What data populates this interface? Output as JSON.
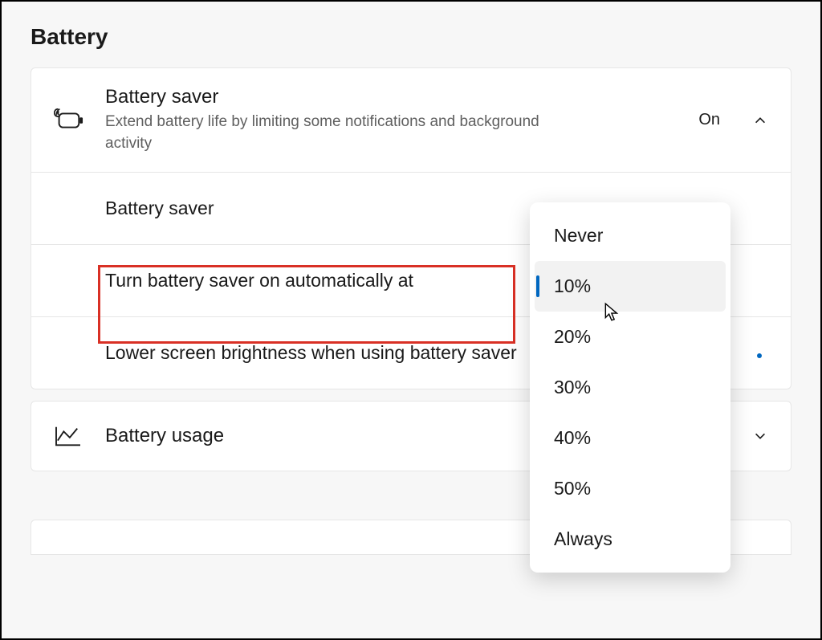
{
  "section_title": "Battery",
  "battery_saver": {
    "title": "Battery saver",
    "description": "Extend battery life by limiting some notifications and background activity",
    "status": "On",
    "rows": {
      "toggle_label": "Battery saver",
      "auto_label": "Turn battery saver on automatically at",
      "brightness_label": "Lower screen brightness when using battery saver"
    }
  },
  "battery_usage": {
    "title": "Battery usage"
  },
  "dropdown": {
    "options": [
      "Never",
      "10%",
      "20%",
      "30%",
      "40%",
      "50%",
      "Always"
    ],
    "selected": "10%"
  }
}
